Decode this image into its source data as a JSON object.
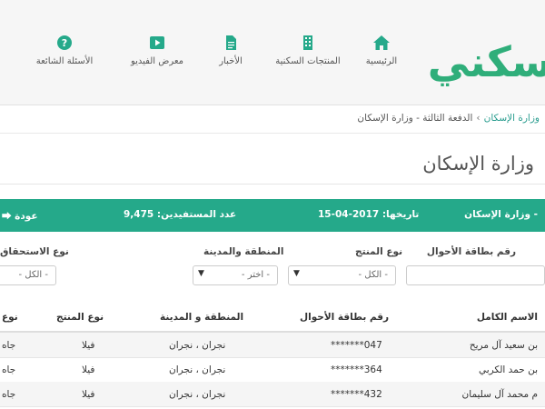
{
  "brand": {
    "logo_text": "سكني",
    "accent": "#25a98a"
  },
  "nav": [
    {
      "label": "الرئيسية",
      "icon": "home-icon"
    },
    {
      "label": "المنتجات السكنية",
      "icon": "building-icon"
    },
    {
      "label": "الأخبار",
      "icon": "document-icon"
    },
    {
      "label": "معرض الفيديو",
      "icon": "video-play-icon"
    },
    {
      "label": "الأسئلة الشائعة",
      "icon": "question-circle-icon"
    }
  ],
  "breadcrumb": {
    "item1": "وزارة الإسكان",
    "item2": "الدفعة الثالثة - وزارة الإسكان"
  },
  "page_title": "وزارة الإسكان",
  "banner": {
    "ministry": "- وزارة الإسكان",
    "date": "تاريخها: 2017-04-15",
    "count": "عدد المستفيدين: 9,475",
    "back": "عودة"
  },
  "filters": {
    "card_number": {
      "label": "رقم بطاقة الأحوال",
      "value": ""
    },
    "product_type": {
      "label": "نوع المنتج",
      "value": "- الكل -"
    },
    "region": {
      "label": "المنطقة والمدينة",
      "value": "- اختر -"
    },
    "entitlement": {
      "label": "نوع الاستحقاق",
      "value": "- الكل -"
    }
  },
  "table": {
    "columns": {
      "name": "الاسم الكامل",
      "card": "رقم بطاقة الأحوال",
      "region": "المنطقة و المدينة",
      "product": "نوع المنتج",
      "entitlement": "نوع"
    },
    "rows": [
      {
        "name": "بن سعيد آل مريح",
        "card": "*******047",
        "region": "نجران ، نجران",
        "product": "فيلا",
        "entitlement": "جاه"
      },
      {
        "name": "بن حمد الكربي",
        "card": "*******364",
        "region": "نجران ، نجران",
        "product": "فيلا",
        "entitlement": "جاه"
      },
      {
        "name": "م محمد آل سليمان",
        "card": "*******432",
        "region": "نجران ، نجران",
        "product": "فيلا",
        "entitlement": "جاه"
      }
    ]
  }
}
